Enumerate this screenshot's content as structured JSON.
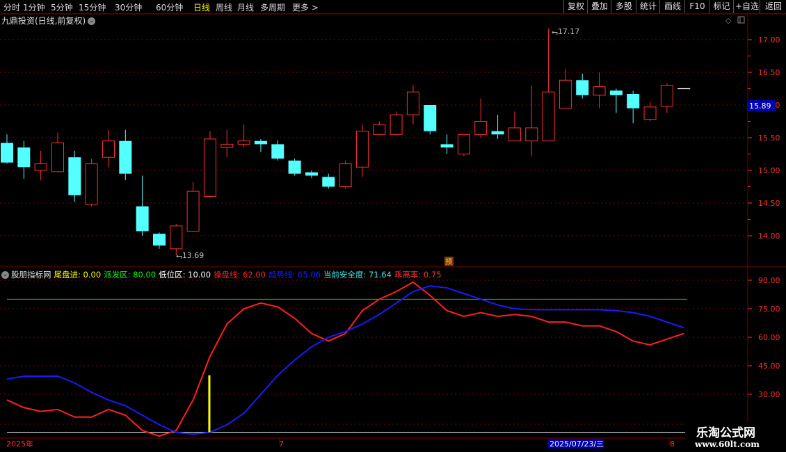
{
  "toolbar": {
    "left": [
      "分时",
      "1分钟",
      "5分钟",
      "15分钟",
      "30分钟",
      "60分钟",
      "日线",
      "周线",
      "月线",
      "多周期",
      "更多 >"
    ],
    "active": "日线",
    "right": [
      "复权",
      "叠加",
      "多股",
      "统计",
      "画线",
      "F10",
      "标记",
      "+自选",
      "返回"
    ]
  },
  "main": {
    "title": "九鼎投资(日线,前复权)",
    "high_label": "17.17",
    "low_label": "13.69",
    "price_tag": "15.89",
    "marker": "预",
    "y_ticks": [
      "17.00",
      "16.50",
      "16.00",
      "15.50",
      "15.00",
      "14.50",
      "14.00"
    ]
  },
  "sub": {
    "name": "股朋指标网",
    "items": [
      {
        "text": "尾盘进: 0.00",
        "color": "#ffff00"
      },
      {
        "text": "派发区: 80.00",
        "color": "#00ff00"
      },
      {
        "text": "低位区: 10.00",
        "color": "#ffffff"
      },
      {
        "text": "操盘线: 62.00",
        "color": "#ff2020"
      },
      {
        "text": "趋势线: 65.06",
        "color": "#1a1aff"
      },
      {
        "text": "当前安全度: 71.64",
        "color": "#40e0e0"
      },
      {
        "text": "乖离率: 0.75",
        "color": "#ff3030"
      }
    ],
    "y_ticks": [
      "90.00",
      "75.00",
      "60.00",
      "45.00",
      "30.00"
    ]
  },
  "xaxis": {
    "year": "2025年",
    "m7": "7",
    "date": "2025/07/23/三",
    "m8": "8"
  },
  "watermark": {
    "line1": "乐淘公式网",
    "line2": "www.60lt.com"
  },
  "chart_data": [
    {
      "type": "candlestick",
      "title": "九鼎投资(日线,前复权)",
      "ylim": [
        13.6,
        17.5
      ],
      "candles": [
        {
          "o": 15.42,
          "h": 15.55,
          "l": 15.1,
          "c": 15.12
        },
        {
          "o": 15.35,
          "h": 15.45,
          "l": 14.87,
          "c": 15.05
        },
        {
          "o": 15.0,
          "h": 15.3,
          "l": 14.85,
          "c": 15.1
        },
        {
          "o": 14.98,
          "h": 15.58,
          "l": 14.98,
          "c": 15.42
        },
        {
          "o": 15.2,
          "h": 15.3,
          "l": 14.52,
          "c": 14.62
        },
        {
          "o": 14.48,
          "h": 15.18,
          "l": 14.45,
          "c": 15.1
        },
        {
          "o": 15.2,
          "h": 15.62,
          "l": 15.05,
          "c": 15.45
        },
        {
          "o": 15.45,
          "h": 15.62,
          "l": 14.85,
          "c": 14.95
        },
        {
          "o": 14.45,
          "h": 14.92,
          "l": 14.0,
          "c": 14.07
        },
        {
          "o": 14.03,
          "h": 14.05,
          "l": 13.8,
          "c": 13.85
        },
        {
          "o": 13.8,
          "h": 14.18,
          "l": 13.7,
          "c": 14.15
        },
        {
          "o": 14.07,
          "h": 14.82,
          "l": 14.07,
          "c": 14.68
        },
        {
          "o": 14.6,
          "h": 15.6,
          "l": 14.58,
          "c": 15.48
        },
        {
          "o": 15.35,
          "h": 15.62,
          "l": 15.2,
          "c": 15.4
        },
        {
          "o": 15.4,
          "h": 15.7,
          "l": 15.35,
          "c": 15.45
        },
        {
          "o": 15.45,
          "h": 15.48,
          "l": 15.28,
          "c": 15.4
        },
        {
          "o": 15.4,
          "h": 15.46,
          "l": 15.15,
          "c": 15.18
        },
        {
          "o": 15.15,
          "h": 15.18,
          "l": 14.92,
          "c": 14.95
        },
        {
          "o": 14.97,
          "h": 15.0,
          "l": 14.88,
          "c": 14.92
        },
        {
          "o": 14.9,
          "h": 14.95,
          "l": 14.72,
          "c": 14.75
        },
        {
          "o": 14.75,
          "h": 15.15,
          "l": 14.72,
          "c": 15.1
        },
        {
          "o": 15.05,
          "h": 15.7,
          "l": 14.9,
          "c": 15.6
        },
        {
          "o": 15.55,
          "h": 15.75,
          "l": 15.55,
          "c": 15.7
        },
        {
          "o": 15.55,
          "h": 15.9,
          "l": 15.55,
          "c": 15.85
        },
        {
          "o": 15.85,
          "h": 16.3,
          "l": 15.7,
          "c": 16.2
        },
        {
          "o": 16.0,
          "h": 16.0,
          "l": 15.55,
          "c": 15.6
        },
        {
          "o": 15.4,
          "h": 15.55,
          "l": 15.25,
          "c": 15.35
        },
        {
          "o": 15.25,
          "h": 15.55,
          "l": 15.22,
          "c": 15.55
        },
        {
          "o": 15.55,
          "h": 16.1,
          "l": 15.5,
          "c": 15.75
        },
        {
          "o": 15.6,
          "h": 15.85,
          "l": 15.48,
          "c": 15.55
        },
        {
          "o": 15.45,
          "h": 15.9,
          "l": 15.45,
          "c": 15.65
        },
        {
          "o": 15.45,
          "h": 16.3,
          "l": 15.22,
          "c": 15.65
        },
        {
          "o": 15.45,
          "h": 17.17,
          "l": 15.45,
          "c": 16.2
        },
        {
          "o": 15.95,
          "h": 16.55,
          "l": 15.95,
          "c": 16.38
        },
        {
          "o": 16.38,
          "h": 16.48,
          "l": 16.1,
          "c": 16.15
        },
        {
          "o": 16.15,
          "h": 16.5,
          "l": 15.95,
          "c": 16.28
        },
        {
          "o": 16.22,
          "h": 16.25,
          "l": 15.88,
          "c": 16.15
        },
        {
          "o": 16.17,
          "h": 16.22,
          "l": 15.72,
          "c": 15.95
        },
        {
          "o": 15.78,
          "h": 16.05,
          "l": 15.75,
          "c": 15.97
        },
        {
          "o": 15.98,
          "h": 16.33,
          "l": 15.88,
          "c": 16.3
        },
        {
          "o": 16.25,
          "h": 16.25,
          "l": 16.25,
          "c": 16.25
        }
      ]
    },
    {
      "type": "line",
      "title": "股朋指标网",
      "ylim": [
        13,
        98
      ],
      "series": [
        {
          "name": "操盘线",
          "color": "#ff2020",
          "values": [
            27,
            23,
            21,
            22,
            18,
            18,
            22,
            19,
            11,
            8,
            11,
            27,
            50,
            67,
            75,
            78,
            76,
            70,
            62,
            58,
            62,
            74,
            80,
            84,
            89,
            82,
            74,
            71,
            73,
            71,
            72,
            71,
            68,
            68,
            66,
            66,
            63,
            58,
            56,
            59,
            62
          ]
        },
        {
          "name": "趋势线",
          "color": "#1a1aff",
          "values": [
            38,
            39.5,
            39.5,
            39.5,
            36,
            31,
            27,
            24,
            19,
            14,
            10,
            9,
            10,
            14,
            20,
            30,
            40,
            48,
            55,
            60,
            63,
            67,
            72,
            78,
            84,
            87,
            86,
            83,
            80,
            77,
            75,
            74.5,
            74.5,
            74.5,
            74.5,
            74.5,
            74,
            73,
            71,
            68,
            65
          ]
        }
      ],
      "hlines": [
        {
          "name": "派发区",
          "value": 80
        },
        {
          "name": "低位区",
          "value": 10
        }
      ],
      "signal_bar": {
        "index": 12,
        "from": 10,
        "to": 40,
        "color": "#ffff00"
      }
    }
  ]
}
